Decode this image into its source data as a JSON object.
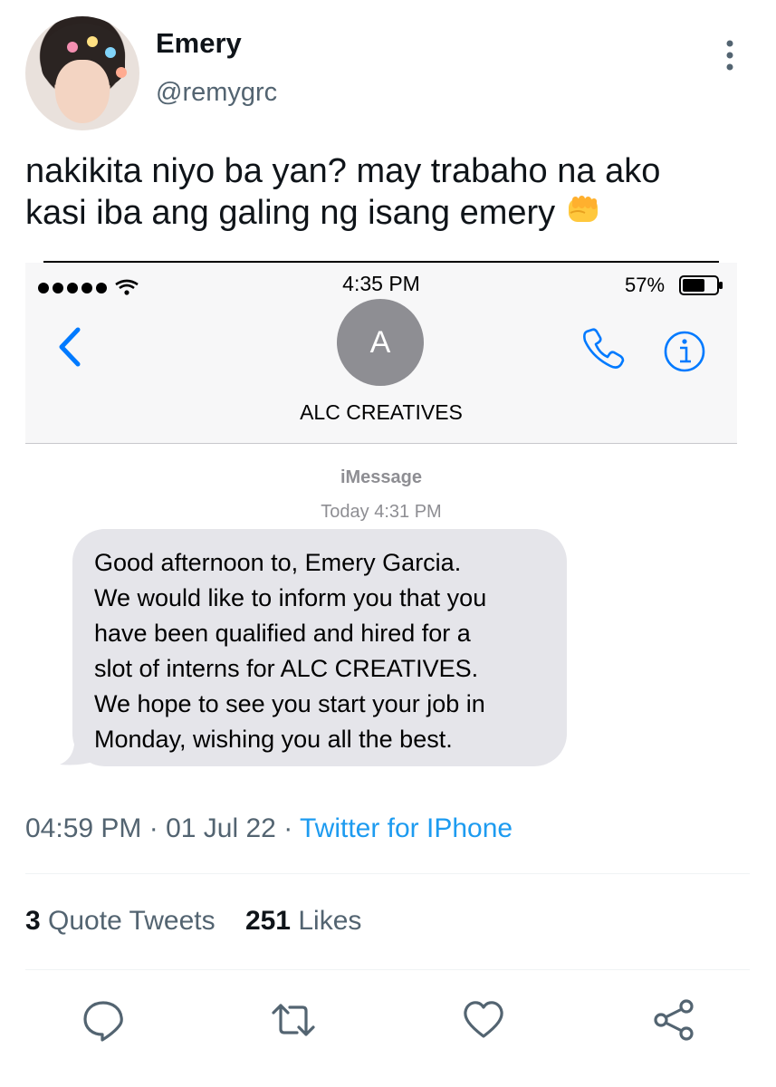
{
  "author": {
    "display_name": "Emery",
    "handle": "@remygrc"
  },
  "tweet": {
    "text_line1": "nakikita niyo ba yan? may trabaho na ako",
    "text_line2": "kasi iba ang galing ng isang emery",
    "emoji": "fisted-hand"
  },
  "screenshot": {
    "status_time": "4:35 PM",
    "battery_percent": "57%",
    "contact_initial": "A",
    "contact_name": "ALC CREATIVES",
    "service": "iMessage",
    "message_time": "Today 4:31 PM",
    "message_lines": [
      "Good afternoon to, Emery Garcia.",
      "We would like to inform you that you",
      "have been qualified and hired for a",
      "slot of interns for ALC CREATIVES.",
      "We hope to see you start your job in",
      "Monday, wishing you all the best."
    ],
    "accent_color": "#007aff"
  },
  "meta": {
    "time": "04:59 PM",
    "sep1": " · ",
    "date": "01 Jul 22",
    "sep2": " · ",
    "source": "Twitter for IPhone"
  },
  "stats": {
    "quote_count": "3",
    "quote_label": "Quote Tweets",
    "like_count": "251",
    "like_label": "Likes"
  },
  "actions": [
    "reply-icon",
    "retweet-icon",
    "like-icon",
    "share-icon"
  ]
}
